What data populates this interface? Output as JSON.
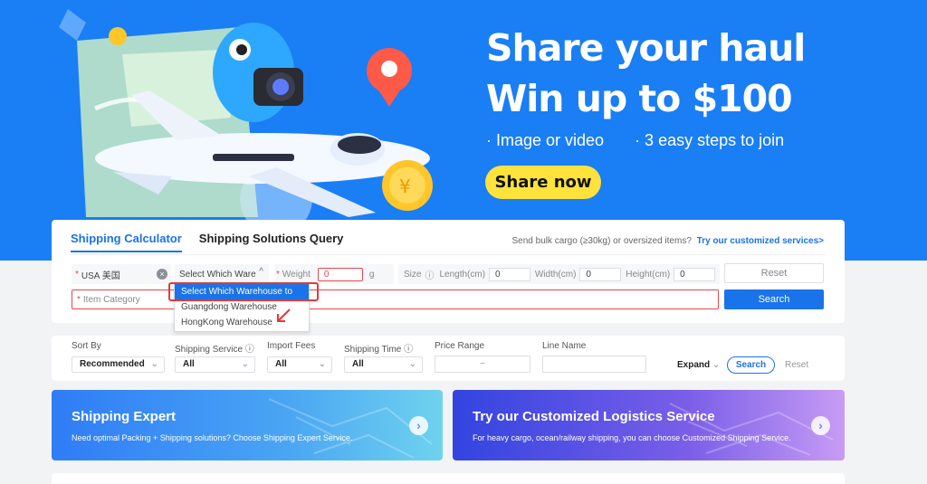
{
  "banner": {
    "headline_line1": "Share your haul",
    "headline_line2": "Win up to $100",
    "bullet1": "· Image or video",
    "bullet2": "· 3 easy steps to join",
    "cta": "Share now",
    "cta_color": "#ffe23c",
    "bg_color": "#1a7ef5"
  },
  "calculator": {
    "tabs": [
      {
        "label": "Shipping Calculator",
        "active": true
      },
      {
        "label": "Shipping Solutions Query",
        "active": false
      }
    ],
    "bulk_text": "Send bulk cargo (≥30kg) or oversized items?",
    "bulk_link": "Try our customized services>",
    "country_value": "USA 美国",
    "warehouse_value": "Select Which Ware",
    "weight_label": "Weight",
    "weight_value": "0",
    "weight_unit": "g",
    "size_label": "Size",
    "length_label": "Length(cm)",
    "length_value": "0",
    "width_label": "Width(cm)",
    "width_value": "0",
    "height_label": "Height(cm)",
    "height_value": "0",
    "reset_label": "Reset",
    "category_placeholder": "Item Category",
    "search_label": "Search",
    "warehouse_options": [
      {
        "label": "Select Which Warehouse to Send",
        "selected": true
      },
      {
        "label": "Guangdong Warehouse",
        "selected": false
      },
      {
        "label": "HongKong Warehouse",
        "selected": false
      }
    ]
  },
  "filters": {
    "sort_by_label": "Sort By",
    "sort_by_value": "Recommended",
    "shipping_service_label": "Shipping Service",
    "shipping_service_value": "All",
    "import_fees_label": "Import Fees",
    "import_fees_value": "All",
    "shipping_time_label": "Shipping Time",
    "shipping_time_value": "All",
    "price_range_label": "Price Range",
    "price_range_sep": "~",
    "line_name_label": "Line Name",
    "expand_label": "Expand",
    "search_label": "Search",
    "reset_label": "Reset"
  },
  "cards": [
    {
      "title": "Shipping Expert",
      "desc": "Need optimal Packing + Shipping solutions? Choose Shipping Expert Service."
    },
    {
      "title": "Try our Customized Logistics Service",
      "desc": "For heavy cargo, ocean/railway shipping, you can choose Customized Shipping Service."
    }
  ],
  "colors": {
    "accent": "#1a73e8",
    "error": "#e5484d"
  }
}
